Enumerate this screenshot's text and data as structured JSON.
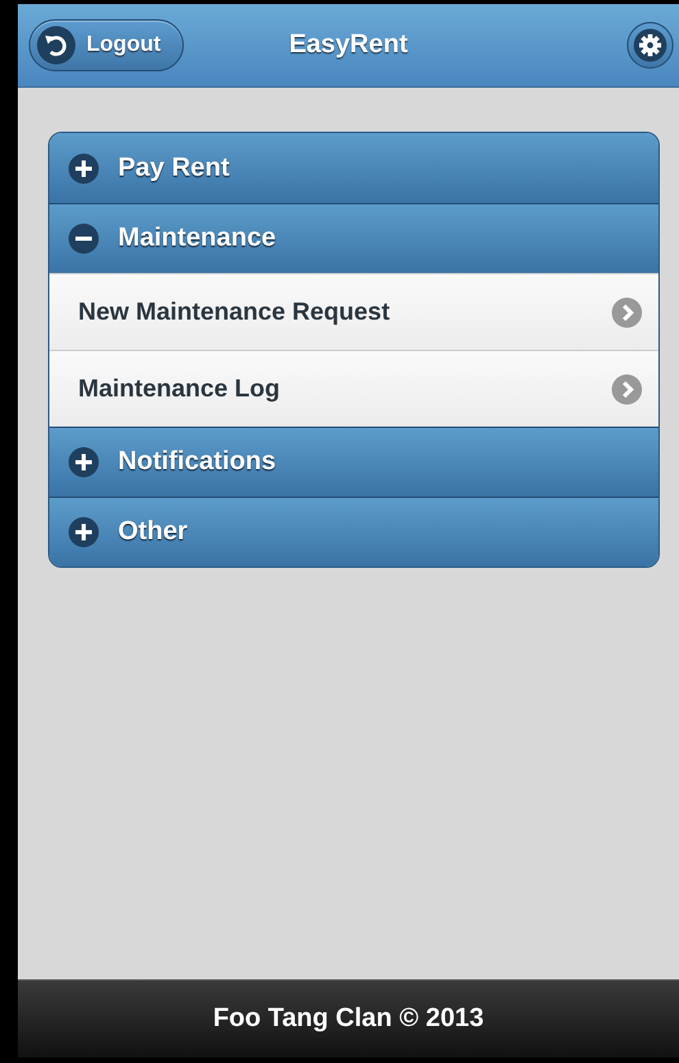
{
  "header": {
    "title": "EasyRent",
    "logout_button": "Logout"
  },
  "sections": [
    {
      "label": "Pay Rent",
      "expanded": false
    },
    {
      "label": "Maintenance",
      "expanded": true,
      "items": [
        {
          "label": "New Maintenance Request"
        },
        {
          "label": "Maintenance Log"
        }
      ]
    },
    {
      "label": "Notifications",
      "expanded": false
    },
    {
      "label": "Other",
      "expanded": false
    }
  ],
  "footer": {
    "text": "Foo Tang Clan © 2013"
  }
}
